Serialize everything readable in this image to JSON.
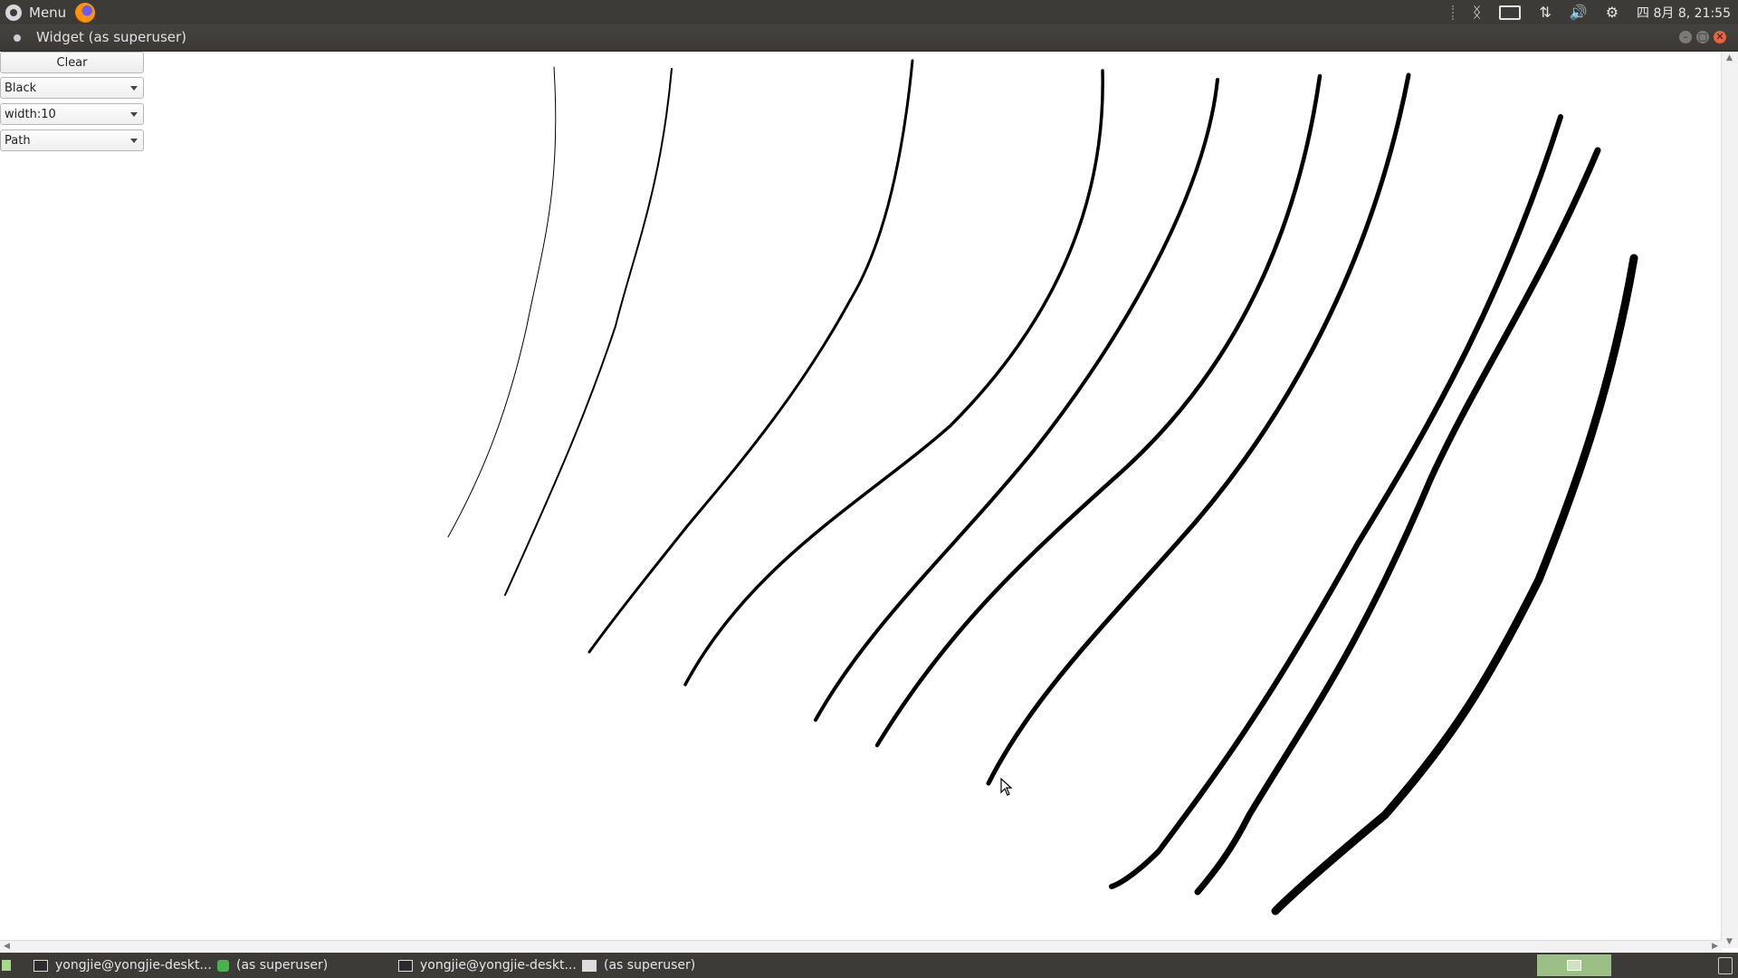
{
  "top_panel": {
    "menu_label": "Menu",
    "clock": "四 8月  8, 21:55",
    "icons": [
      "menu-logo-icon",
      "firefox-icon",
      "bluetooth-icon",
      "keyboard-icon",
      "network-icon",
      "volume-icon",
      "settings-icon"
    ]
  },
  "window": {
    "title": "Widget (as superuser)",
    "controls": [
      "minimize",
      "maximize",
      "close"
    ]
  },
  "controls": {
    "clear_label": "Clear",
    "color_value": "Black",
    "width_value": "width:10",
    "mode_value": "Path"
  },
  "canvas": {
    "stroke_color": "#000000"
  },
  "taskbar": {
    "tasks": [
      {
        "label": "yongjie@yongjie-deskt...",
        "icon": "terminal-icon"
      },
      {
        "label": "(as superuser)",
        "icon": "shield-icon"
      },
      {
        "label": "yongjie@yongjie-deskt...",
        "icon": "terminal-icon"
      },
      {
        "label": "(as superuser)",
        "icon": "window-icon"
      }
    ]
  }
}
